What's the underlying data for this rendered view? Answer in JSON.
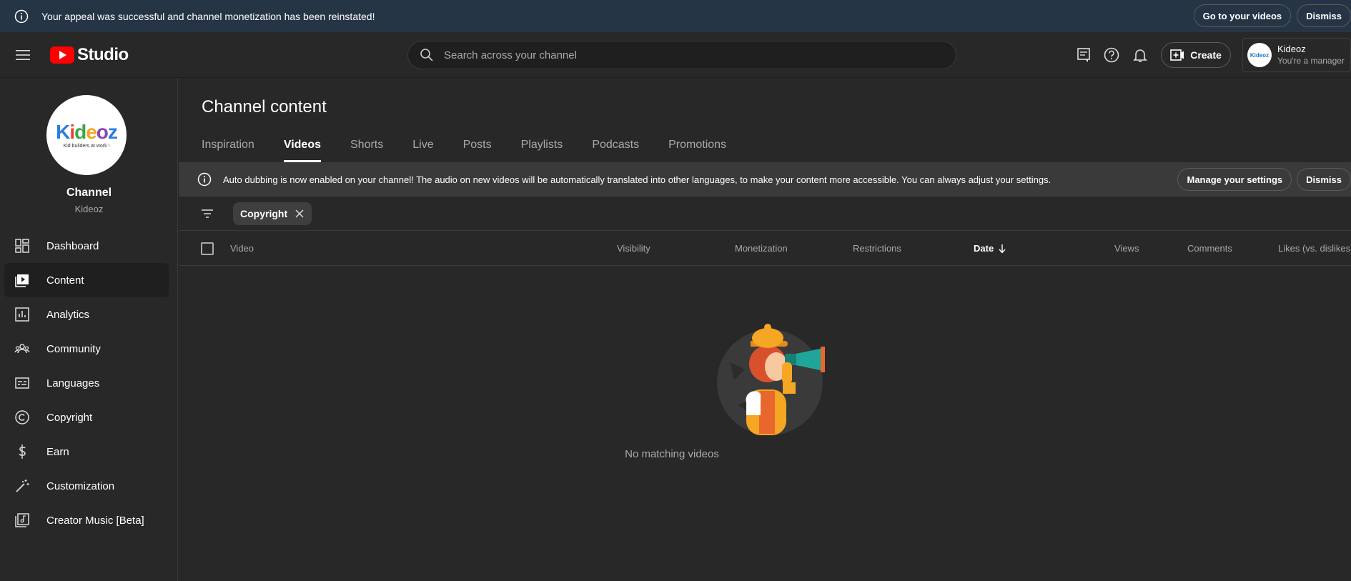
{
  "appeal_banner": {
    "message": "Your appeal was successful and channel monetization has been reinstated!",
    "go_to_videos_label": "Go to your videos",
    "dismiss_label": "Dismiss"
  },
  "header": {
    "logo_text": "Studio",
    "search_placeholder": "Search across your channel",
    "create_label": "Create",
    "account_name": "Kideoz",
    "account_role": "You're a manager",
    "brand_color": "#ff0000"
  },
  "sidebar": {
    "channel_title": "Channel",
    "channel_name": "Kideoz",
    "avatar_word": "Kideoz",
    "avatar_tagline": "Kid builders at work !",
    "items": [
      {
        "label": "Dashboard",
        "icon": "dashboard-icon"
      },
      {
        "label": "Content",
        "icon": "content-icon",
        "active": true
      },
      {
        "label": "Analytics",
        "icon": "analytics-icon"
      },
      {
        "label": "Community",
        "icon": "community-icon"
      },
      {
        "label": "Languages",
        "icon": "languages-icon"
      },
      {
        "label": "Copyright",
        "icon": "copyright-icon"
      },
      {
        "label": "Earn",
        "icon": "earn-icon"
      },
      {
        "label": "Customization",
        "icon": "customization-icon"
      },
      {
        "label": "Creator Music [Beta]",
        "icon": "creator-music-icon"
      }
    ]
  },
  "main": {
    "page_title": "Channel content",
    "tabs": [
      {
        "label": "Inspiration"
      },
      {
        "label": "Videos",
        "active": true
      },
      {
        "label": "Shorts"
      },
      {
        "label": "Live"
      },
      {
        "label": "Posts"
      },
      {
        "label": "Playlists"
      },
      {
        "label": "Podcasts"
      },
      {
        "label": "Promotions"
      }
    ],
    "dubbing_banner": {
      "message": "Auto dubbing is now enabled on your channel! The audio on new videos will be automatically translated into other languages, to make your content more accessible. You can always adjust your settings.",
      "manage_label": "Manage your settings",
      "dismiss_label": "Dismiss"
    },
    "filter_chip": "Copyright",
    "columns": {
      "video": "Video",
      "visibility": "Visibility",
      "monetization": "Monetization",
      "restrictions": "Restrictions",
      "date": "Date",
      "views": "Views",
      "comments": "Comments",
      "likes": "Likes (vs. dislikes)"
    },
    "sort_column": "date",
    "sort_direction": "descending",
    "empty_message": "No matching videos"
  }
}
